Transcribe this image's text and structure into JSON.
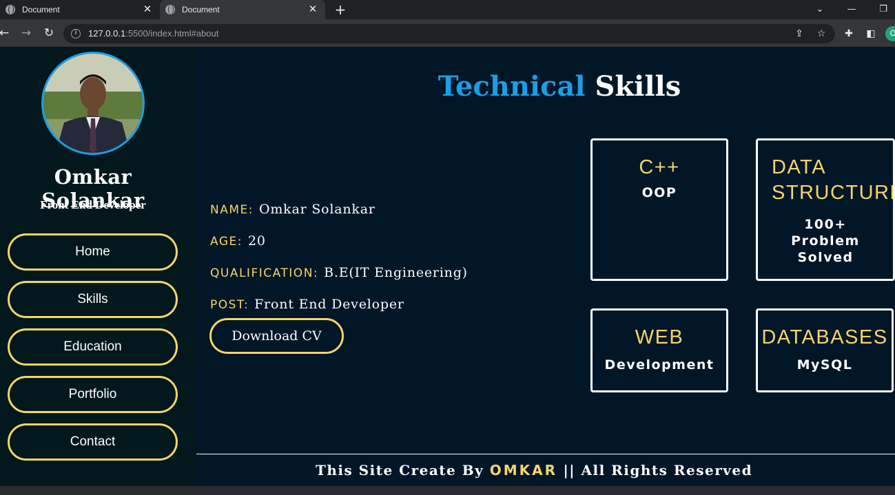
{
  "browser": {
    "tabs": [
      {
        "title": "Document",
        "close": "✕"
      },
      {
        "title": "Document",
        "close": "✕"
      }
    ],
    "new_tab": "+",
    "url_host": "127.0.0.1",
    "url_rest": ":5500/index.html#about",
    "profile_initial": "O"
  },
  "sidebar": {
    "name": "Omkar Solankar",
    "role": "Front End Developer",
    "nav": [
      "Home",
      "Skills",
      "Education",
      "Portfolio",
      "Contact"
    ]
  },
  "heading": {
    "accent": "Technical",
    "rest": "Skills"
  },
  "about": {
    "rows": [
      {
        "label": "NAME:",
        "value": "Omkar Solankar"
      },
      {
        "label": "AGE:",
        "value": "20"
      },
      {
        "label": "QUALIFICATION:",
        "value": "B.E(IT Engineering)"
      },
      {
        "label": "POST:",
        "value": "Front End Developer"
      }
    ],
    "cv_button": "Download CV"
  },
  "skills": [
    {
      "title_lines": [
        "C++"
      ],
      "sub_lines": [
        "OOP"
      ]
    },
    {
      "title_lines": [
        "DATA",
        "STRUCTURES"
      ],
      "sub_lines": [
        "100+",
        "Problem",
        "Solved"
      ]
    },
    {
      "title_lines": [
        "WEB"
      ],
      "sub_lines": [
        "Development"
      ]
    },
    {
      "title_lines": [
        "DATABASES"
      ],
      "sub_lines": [
        "MySQL"
      ]
    }
  ],
  "footer": {
    "prefix": "This Site Create By",
    "brand": "OMKAR",
    "suffix": "|| All Rights Reserved"
  },
  "colors": {
    "accent_blue": "#1a9ee8",
    "accent_yellow": "#f8d568",
    "page_bg": "#011627",
    "sidebar_bg": "#02181c"
  }
}
